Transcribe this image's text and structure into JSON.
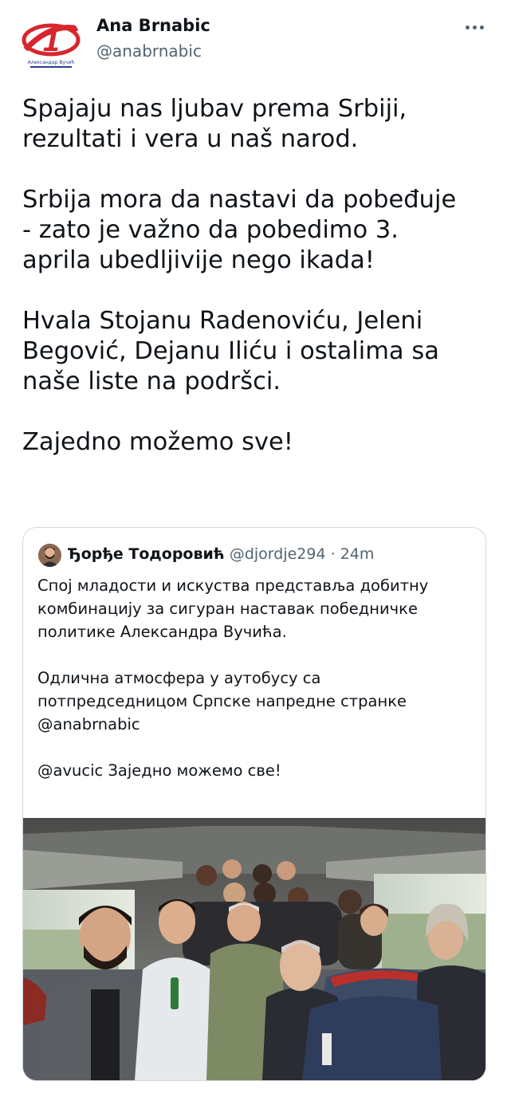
{
  "tweet": {
    "author": {
      "name": "Ana Brnabic",
      "handle": "@anabrnabic",
      "avatar_icon": "sns-party-logo-icon",
      "avatar_caption": "Александар Вучић"
    },
    "more_icon": "more-dots-icon",
    "text_paragraphs": [
      [
        "Spajaju nas ljubav prema Srbiji,",
        "rezultati i vera u naš narod."
      ],
      [
        "Srbija mora da nastavi da pobeđuje",
        "- zato je važno da pobedimo 3.",
        "aprila ubedljivije nego ikada!"
      ],
      [
        "Hvala Stojanu Radenoviću, Jeleni",
        "Begović, Dejanu Iliću i ostalima sa",
        "naše liste na podršci."
      ],
      [
        "Zajedno možemo sve!"
      ]
    ]
  },
  "quote": {
    "name": "Ђорђе Тодоровић",
    "handle": "@djordje294",
    "separator": "·",
    "time": "24m",
    "text_paragraphs": [
      [
        "Спој младости и искуства представља добитну",
        "комбинацију за сигуран наставак победничке",
        "политике Александра Вучића."
      ],
      [
        "Одлична атмосфера у аутобусу са",
        "потпредседницом Српске напредне странке",
        "@anabrnabic"
      ],
      [
        "@avucic Заједно можемо све!"
      ]
    ],
    "photo_description_icon": "bus-group-photo"
  },
  "colors": {
    "text": "#0f1419",
    "secondary": "#536471",
    "border": "#cfd9de",
    "logo_red": "#d7262e"
  }
}
